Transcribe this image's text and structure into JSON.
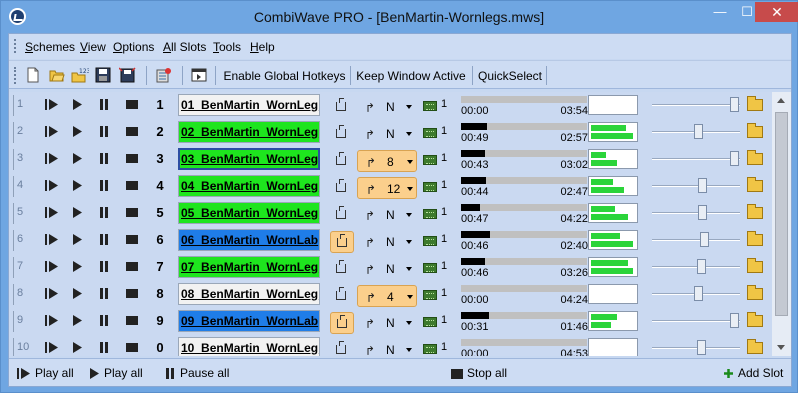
{
  "window": {
    "title": "CombiWave PRO - [BenMartin-Wornlegs.mws]",
    "controls": {
      "minimize": "—",
      "maximize": "☐",
      "close": "✕"
    }
  },
  "menu": {
    "items": [
      {
        "label": "Schemes",
        "u": "S",
        "rest": "chemes"
      },
      {
        "label": "View",
        "u": "V",
        "rest": "iew"
      },
      {
        "label": "Options",
        "u": "O",
        "rest": "ptions"
      },
      {
        "label": "All Slots",
        "u": "A",
        "rest": "ll Slots"
      },
      {
        "label": "Tools",
        "u": "T",
        "rest": "ools"
      },
      {
        "label": "Help",
        "u": "H",
        "rest": "elp"
      }
    ]
  },
  "toolbar": {
    "icons": [
      "new-file-icon",
      "open-folder-icon",
      "open-numbered-icon",
      "save-icon",
      "save-all-icon",
      "settings-icon",
      "window-icon"
    ],
    "buttons": [
      "Enable Global Hotkeys",
      "Keep Window Active",
      "QuickSelect"
    ]
  },
  "slots": [
    {
      "index": "1",
      "key": "1",
      "name": "01_BenMartin_WornLeg",
      "color": "#f2f2f2",
      "loop_active": false,
      "repeat_active": false,
      "repeat": "N",
      "device": "1",
      "elapsed": "00:00",
      "total": "03:54",
      "progress": 0,
      "vu_l": 0,
      "vu_r": 0,
      "volume": 0.98
    },
    {
      "index": "2",
      "key": "2",
      "name": "02_BenMartin_WornLeg",
      "color": "#1ee51e",
      "loop_active": false,
      "repeat_active": false,
      "repeat": "N",
      "device": "1",
      "elapsed": "00:49",
      "total": "02:57",
      "progress": 0.21,
      "vu_l": 0.8,
      "vu_r": 0.95,
      "volume": 0.52
    },
    {
      "index": "3",
      "key": "3",
      "name": "03_BenMartin_WornLeg",
      "color": "#1ee51e",
      "selected": true,
      "loop_active": false,
      "repeat_active": true,
      "repeat": "8",
      "device": "1",
      "elapsed": "00:43",
      "total": "03:02",
      "progress": 0.19,
      "vu_l": 0.35,
      "vu_r": 0.6,
      "volume": 0.98
    },
    {
      "index": "4",
      "key": "4",
      "name": "04_BenMartin_WornLeg",
      "color": "#1ee51e",
      "loop_active": false,
      "repeat_active": true,
      "repeat": "12",
      "device": "1",
      "elapsed": "00:44",
      "total": "02:47",
      "progress": 0.2,
      "vu_l": 0.5,
      "vu_r": 0.75,
      "volume": 0.58
    },
    {
      "index": "5",
      "key": "5",
      "name": "05_BenMartin_WornLeg",
      "color": "#1ee51e",
      "loop_active": false,
      "repeat_active": false,
      "repeat": "N",
      "device": "1",
      "elapsed": "00:47",
      "total": "04:22",
      "progress": 0.15,
      "vu_l": 0.55,
      "vu_r": 0.85,
      "volume": 0.58
    },
    {
      "index": "6",
      "key": "6",
      "name": "06_BenMartin_WornLab",
      "color": "#1f7de8",
      "loop_active": true,
      "repeat_active": false,
      "repeat": "N",
      "device": "1",
      "elapsed": "00:46",
      "total": "02:40",
      "progress": 0.23,
      "vu_l": 0.65,
      "vu_r": 0.95,
      "volume": 0.6
    },
    {
      "index": "7",
      "key": "7",
      "name": "07_BenMartin_WornLeg",
      "color": "#1ee51e",
      "loop_active": false,
      "repeat_active": false,
      "repeat": "N",
      "device": "1",
      "elapsed": "00:46",
      "total": "03:26",
      "progress": 0.19,
      "vu_l": 0.85,
      "vu_r": 0.95,
      "volume": 0.56
    },
    {
      "index": "8",
      "key": "8",
      "name": "08_BenMartin_WornLeg",
      "color": "#f2f2f2",
      "loop_active": false,
      "repeat_active": true,
      "repeat": "4",
      "device": "1",
      "elapsed": "00:00",
      "total": "04:24",
      "progress": 0,
      "vu_l": 0,
      "vu_r": 0,
      "volume": 0.53
    },
    {
      "index": "9",
      "key": "9",
      "name": "09_BenMartin_WornLab",
      "color": "#1f7de8",
      "loop_active": true,
      "repeat_active": false,
      "repeat": "N",
      "device": "1",
      "elapsed": "00:31",
      "total": "01:46",
      "progress": 0.22,
      "vu_l": 0.6,
      "vu_r": 0.45,
      "volume": 0.98
    },
    {
      "index": "10",
      "key": "0",
      "name": "10_BenMartin_WornLeg",
      "color": "#f2f2f2",
      "loop_active": false,
      "repeat_active": false,
      "repeat": "N",
      "device": "1",
      "elapsed": "00:00",
      "total": "04:53",
      "progress": 0,
      "vu_l": 0,
      "vu_r": 0,
      "volume": 0.56
    }
  ],
  "footer": {
    "play_all": "Play all",
    "play_all_2": "Play all",
    "pause_all": "Pause all",
    "stop_all": "Stop all",
    "add_slot": "Add Slot"
  }
}
